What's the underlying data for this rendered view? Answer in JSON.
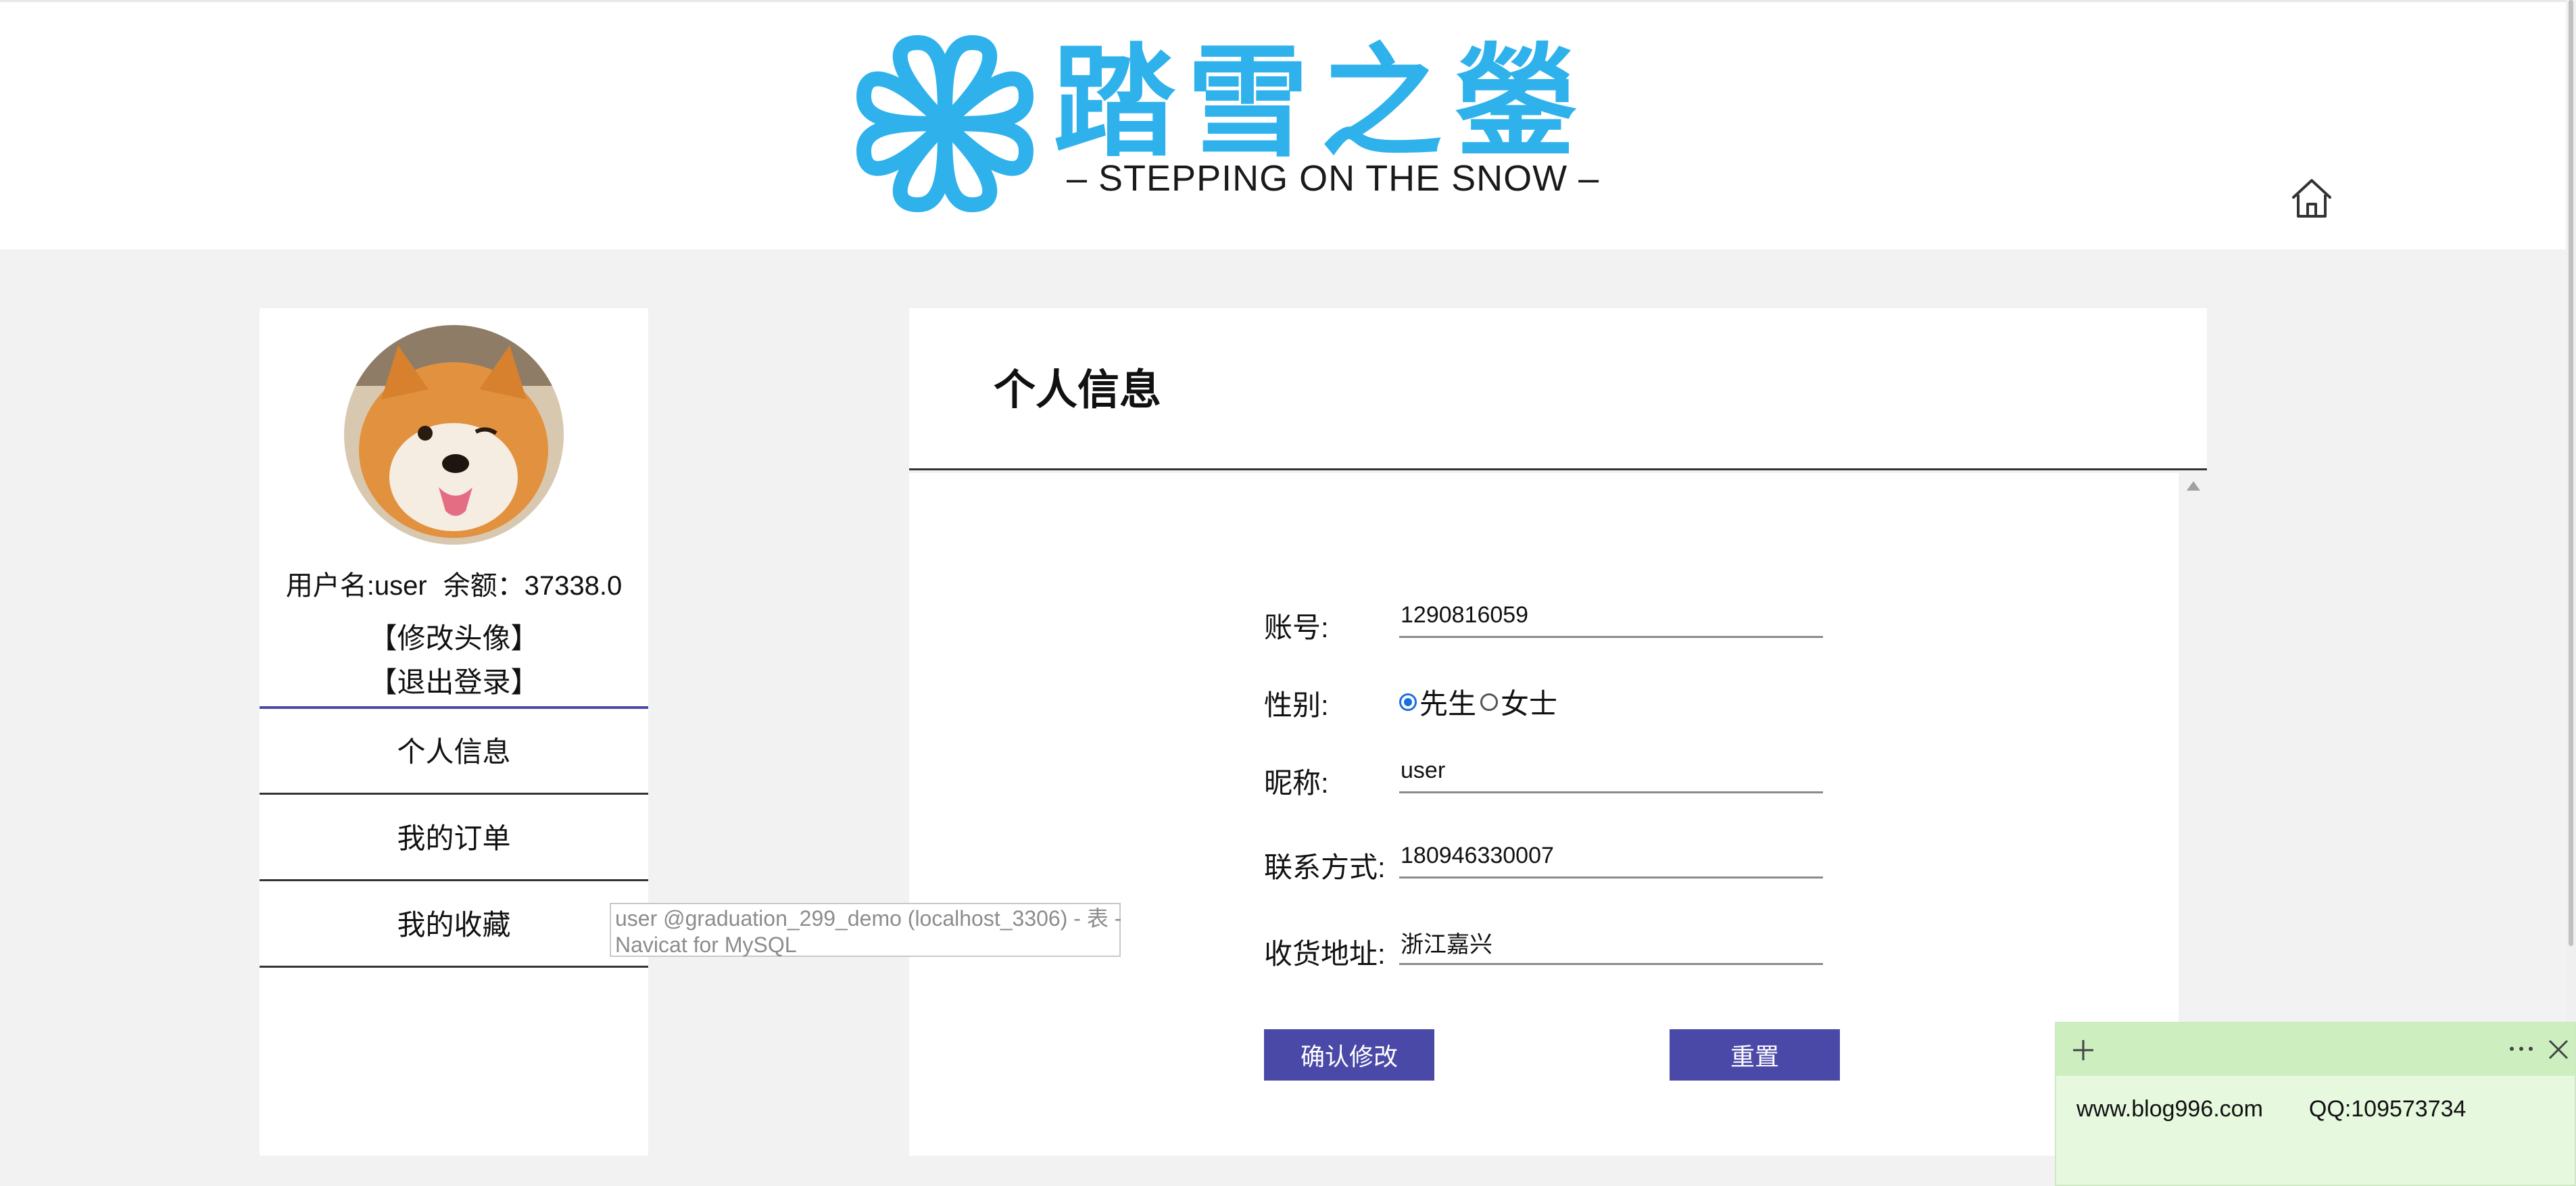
{
  "header": {
    "logo_title": "踏雪之鎣",
    "logo_subtitle": "– STEPPING ON THE SNOW –",
    "home_icon": "home-icon"
  },
  "sidebar": {
    "username_text": "用户名:user",
    "balance_text": "余额：37338.0",
    "change_avatar": "【修改头像】",
    "logout": "【退出登录】",
    "nav": [
      {
        "label": "个人信息"
      },
      {
        "label": "我的订单"
      },
      {
        "label": "我的收藏"
      }
    ]
  },
  "tooltip": {
    "line1": "user @graduation_299_demo (localhost_3306) - 表 -",
    "line2": "Navicat for MySQL"
  },
  "main": {
    "title": "个人信息",
    "form": {
      "account_label": "账号:",
      "account_value": "1290816059",
      "gender_label": "性别:",
      "gender_options": [
        "先生",
        "女士"
      ],
      "gender_selected": "先生",
      "nickname_label": "昵称:",
      "nickname_value": "user",
      "phone_label": "联系方式:",
      "phone_value": "180946330007",
      "address_label": "收货地址:",
      "address_value": "浙江嘉兴"
    },
    "confirm_label": "确认修改",
    "reset_label": "重置"
  },
  "note": {
    "site": "www.blog996.com",
    "qq": "QQ:109573734"
  },
  "colors": {
    "accent": "#4b49a8",
    "logo_blue": "#2fb2ec",
    "note_bg": "#e6f8dd"
  }
}
